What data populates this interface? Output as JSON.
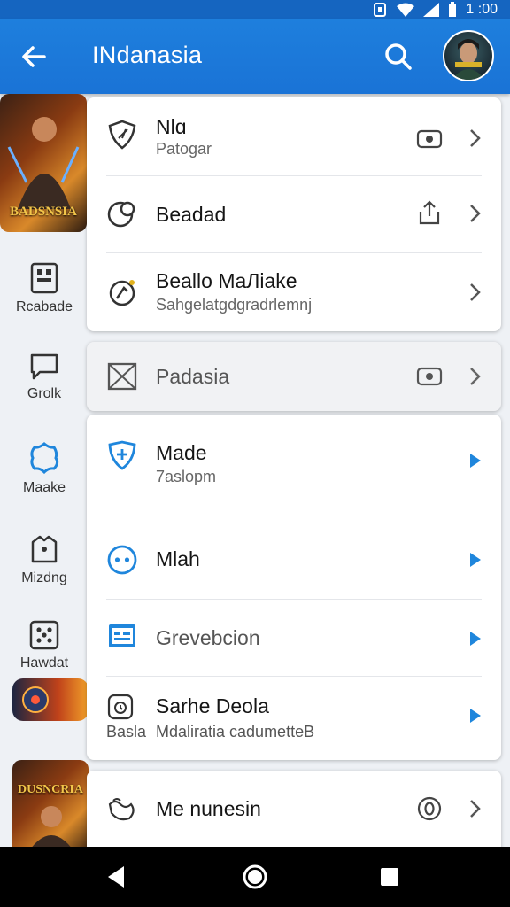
{
  "status": {
    "time": "1 :00"
  },
  "appbar": {
    "title": "INdanasia"
  },
  "rail": {
    "game_top_label": "BADSNSIA",
    "game_bottom_label": "DUSNCRIA",
    "items": [
      {
        "label": "Rcabade",
        "icon": "grid-icon"
      },
      {
        "label": "Grolk",
        "icon": "chat-icon"
      },
      {
        "label": "Maake",
        "icon": "puzzle-icon"
      },
      {
        "label": "Mizdng",
        "icon": "store-icon"
      },
      {
        "label": "Hawdat",
        "icon": "dice-icon"
      }
    ]
  },
  "card1": {
    "rows": [
      {
        "title": "Nlɑ",
        "subtitle": "Patogar",
        "icon": "shield-slash-icon",
        "aux": "toggle-card-icon"
      },
      {
        "title": "Beadad",
        "icon": "moon-icon",
        "aux": "share-icon"
      },
      {
        "title": "Beallo MaЛiake",
        "subtitle": "Sahgelatgdgradrlemnj",
        "icon": "spark-gear-icon"
      }
    ]
  },
  "card2": {
    "title": "Padasia",
    "icon": "mail-x-icon",
    "aux": "toggle-card-icon"
  },
  "card3": {
    "rows": [
      {
        "title": "Made",
        "subtitle": "7aslopm",
        "icon": "shield-plus-icon"
      },
      {
        "title": "Mlah",
        "icon": "dots-circle-icon"
      },
      {
        "title": "Grevebcion",
        "icon": "window-icon"
      },
      {
        "title": "Sarhe Deola",
        "subtitle_prefix": "Basla",
        "subtitle": "Mdaliratia cadumetteB",
        "icon": "clock-badge-icon"
      }
    ]
  },
  "card4": {
    "title": "Me nunesin",
    "icon": "wave-hand-icon",
    "aux": "zero-circle-icon"
  },
  "colors": {
    "accent": "#1e7fdd",
    "blue_icon": "#1f86dc"
  }
}
